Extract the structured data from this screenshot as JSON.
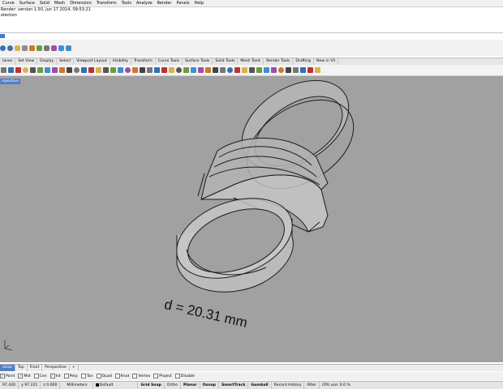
{
  "menu": [
    "Curve",
    "Surface",
    "Solid",
    "Mesh",
    "Dimension",
    "Transform",
    "Tools",
    "Analyze",
    "Render",
    "Panels",
    "Help"
  ],
  "command_history": [
    "Render: version 1.50, Jun 17 2014, 09:53:21",
    "election"
  ],
  "tabs": [
    "lanes",
    "Set View",
    "Display",
    "Select",
    "Viewport Layout",
    "Visibility",
    "Transform",
    "Curve Tools",
    "Surface Tools",
    "Solid Tools",
    "Mesh Tools",
    "Render Tools",
    "Drafting",
    "New in V5"
  ],
  "viewport": {
    "title": "rspective",
    "annotation": "d = 20.31 mm",
    "background": "#a1a1a1"
  },
  "viewport_tabs": {
    "items": [
      "show",
      "Top",
      "Front",
      "Perspective"
    ],
    "add": "+"
  },
  "osnap": [
    "Point",
    "Mid",
    "Cen",
    "Int",
    "Perp",
    "Tan",
    "Quad",
    "Knot",
    "Vertex",
    "Project",
    "Disable"
  ],
  "status": {
    "x": "97.420",
    "y": "y 97.221",
    "z": "z 0.000",
    "units": "Millimeters",
    "layer": "Default",
    "grid_snap": "Grid Snap",
    "ortho": "Ortho",
    "planar": "Planar",
    "osnap": "Osnap",
    "smarttrack": "SmartTrack",
    "gumball": "Gumball",
    "record_history": "Record History",
    "filter": "Filter",
    "cpu": "CPU use: 0.0 %"
  },
  "colors": {
    "accent": "#4f7fc7",
    "viewport_bg": "#a1a1a1"
  }
}
